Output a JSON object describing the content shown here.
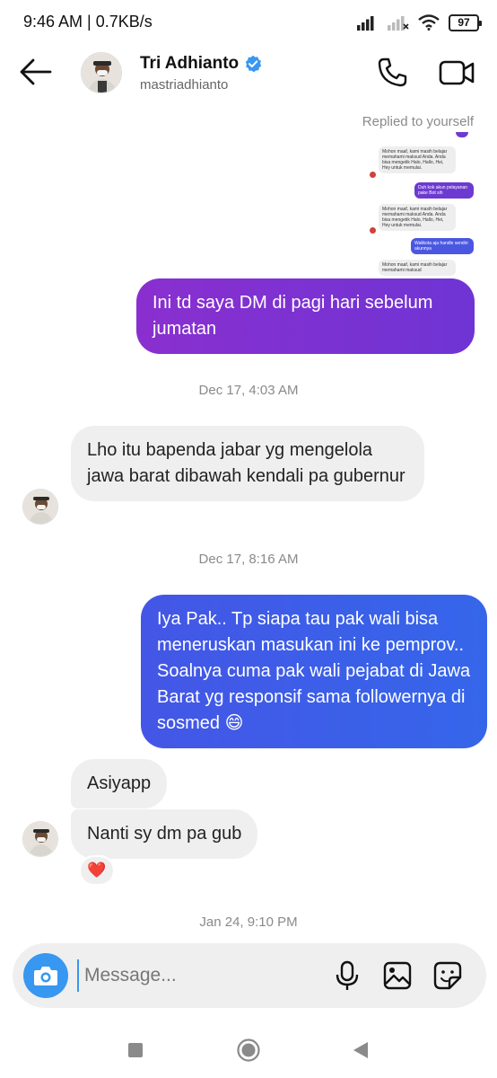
{
  "status_bar": {
    "time": "9:46 AM | 0.7KB/s",
    "battery": "97"
  },
  "header": {
    "name": "Tri Adhianto",
    "username": "mastriadhianto"
  },
  "replied_label": "Replied to yourself",
  "reply_preview": {
    "messages": [
      "Mohon maaf, kami masih belajar memahami maksud Anda. Anda bisa mengetik Halo, Hallo, Hei, Hey untuk memulai.",
      "Duh kok akun pelayanan pake Bot sih",
      "Mohon maaf, kami masih belajar memahami maksud Anda. Anda bisa mengetik Halo, Hallo, Hei, Hey untuk memulai.",
      "Walikota aja handle sendiri akunnya",
      "Mohon maaf, kami masih belajar memahami maksud"
    ]
  },
  "messages": [
    {
      "from": "me",
      "text": "Ini td saya DM di pagi hari sebelum jumatan"
    },
    {
      "timestamp": "Dec 17, 4:03 AM"
    },
    {
      "from": "them",
      "text": "Lho itu bapenda jabar yg mengelola jawa barat dibawah kendali pa gubernur"
    },
    {
      "timestamp": "Dec 17, 8:16 AM"
    },
    {
      "from": "me",
      "text": "Iya Pak.. Tp siapa tau pak wali bisa meneruskan masukan ini ke pemprov.. Soalnya cuma pak wali pejabat di Jawa Barat yg responsif sama followernya di sosmed 😄"
    },
    {
      "from": "them",
      "text": "Asiyapp"
    },
    {
      "from": "them",
      "text": "Nanti sy dm pa gub",
      "reaction": "❤️"
    },
    {
      "timestamp": "Jan 24, 9:10 PM"
    }
  ],
  "composer": {
    "placeholder": "Message..."
  },
  "colors": {
    "accent": "#3897f0",
    "out_bubble_purple": "#7a2bd0",
    "out_bubble_blue": "#3c5ae8",
    "in_bubble": "#efefef",
    "verified": "#3897f0",
    "heart": "#e0245e"
  },
  "icons": [
    "back-arrow-icon",
    "verified-badge-icon",
    "phone-icon",
    "video-camera-icon",
    "camera-icon",
    "microphone-icon",
    "gallery-icon",
    "sticker-icon",
    "nav-square-icon",
    "nav-circle-icon",
    "nav-back-triangle-icon"
  ]
}
